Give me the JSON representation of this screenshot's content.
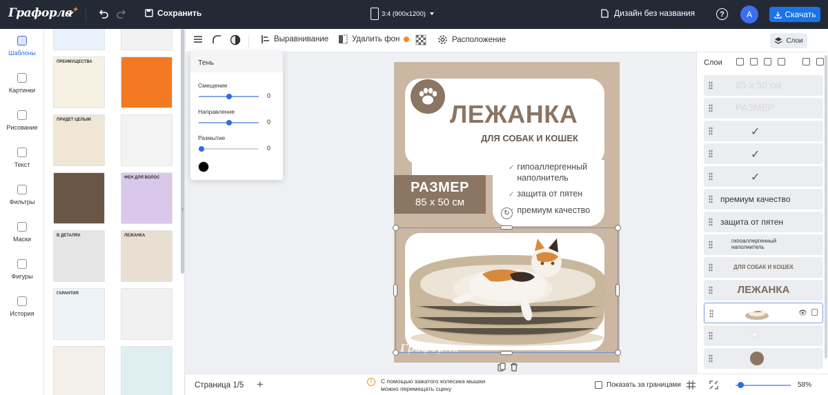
{
  "app": {
    "logo": "Графорла",
    "save_label": "Сохранить",
    "format_label": "3:4 (900x1200)",
    "doc_name": "Дизайн без названия",
    "help": "?",
    "avatar": "A",
    "download_label": "Скачать"
  },
  "rail": [
    {
      "label": "Шаблоны",
      "active": true
    },
    {
      "label": "Картинки"
    },
    {
      "label": "Рисование"
    },
    {
      "label": "Текст"
    },
    {
      "label": "Фильтры"
    },
    {
      "label": "Маски"
    },
    {
      "label": "Фигуры"
    },
    {
      "label": "История"
    }
  ],
  "templates": [
    {
      "caption": "",
      "bg": "#e9f1fb"
    },
    {
      "caption": "",
      "bg": "#f2f2f2"
    },
    {
      "caption": "ПРЕИМУЩЕСТВА",
      "bg": "#f7f1e3"
    },
    {
      "caption": "",
      "bg": "#f37a22"
    },
    {
      "caption": "ПРИДЕТ ЦЕЛЫМ",
      "bg": "#efe6d6"
    },
    {
      "caption": "",
      "bg": "#f3f3f3"
    },
    {
      "caption": "",
      "bg": "#6a5646"
    },
    {
      "caption": "ФЕН ДЛЯ ВОЛОС",
      "bg": "#d9c8ea"
    },
    {
      "caption": "В ДЕТАЛЯХ",
      "bg": "#e6e6e6"
    },
    {
      "caption": "ЛЕЖАНКА",
      "bg": "#e9ded2"
    },
    {
      "caption": "ГАРАНТИЯ",
      "bg": "#eef3f8"
    },
    {
      "caption": "",
      "bg": "#f1f1f1"
    },
    {
      "caption": "",
      "bg": "#f3f0ea"
    },
    {
      "caption": "",
      "bg": "#dfeef0"
    }
  ],
  "toolbar": {
    "align_label": "Выравнивание",
    "remove_bg_label": "Удалить фон",
    "position_label": "Расположение",
    "layers_label": "Слои"
  },
  "shadow_popup": {
    "title": "Тень",
    "offset_label": "Смещение",
    "offset_value": "0",
    "direction_label": "Направление",
    "direction_value": "0",
    "blur_label": "Размытие",
    "blur_value": "0",
    "color": "#000000"
  },
  "artboard": {
    "title": "ЛЕЖАНКА",
    "subtitle": "ДЛЯ СОБАК И КОШЕК",
    "size_title": "РАЗМЕР",
    "size_value": "85 x 50 см",
    "features": [
      "гипоаллергенный\nнаполнитель",
      "защита от пятен",
      "премиум качество"
    ],
    "watermark": "Графорла",
    "accent": "#8b7563"
  },
  "layers": {
    "title": "Слои",
    "items": [
      {
        "label": "85 x 50 см",
        "style": "ghost"
      },
      {
        "label": "РАЗМЕР",
        "style": "ghost"
      },
      {
        "label": "",
        "style": "check"
      },
      {
        "label": "",
        "style": "check"
      },
      {
        "label": "",
        "style": "check"
      },
      {
        "label": "премиум качество",
        "style": "text"
      },
      {
        "label": "защита от пятен",
        "style": "text"
      },
      {
        "label": "гипоаллергенный\nнаполнитель",
        "style": "small"
      },
      {
        "label": "ДЛЯ СОБАК И КОШЕК",
        "style": "brown-small"
      },
      {
        "label": "ЛЕЖАНКА",
        "style": "brown"
      },
      {
        "label": "",
        "style": "image",
        "selected": true
      },
      {
        "label": "",
        "style": "paw"
      },
      {
        "label": "",
        "style": "circle"
      }
    ]
  },
  "status": {
    "page_label": "Страница 1/5",
    "hint": "С помощью зажатого колесика мышки\nможно перемещать сцену",
    "show_bounds_label": "Показать за границами",
    "zoom": "58%"
  }
}
